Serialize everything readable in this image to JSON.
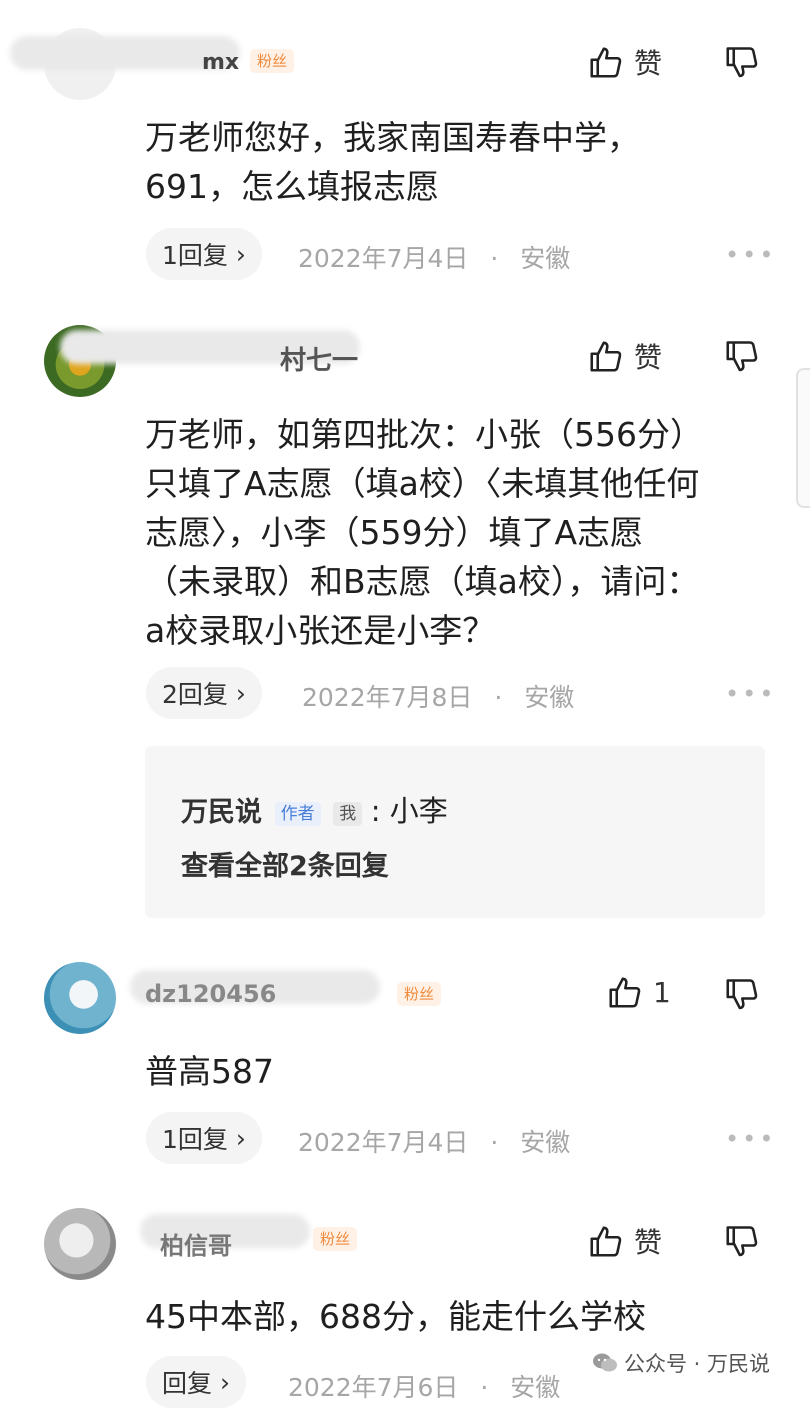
{
  "comments": [
    {
      "name_tail": "mx",
      "badge": "粉丝",
      "like_label": "赞",
      "text_lines": [
        "万老师您好，我家南国寿春中学，",
        "691，怎么填报志愿"
      ],
      "replies_label": "1回复",
      "date": "2022年7月4日",
      "location": "安徽"
    },
    {
      "name_tail": "村七一",
      "like_label": "赞",
      "text_lines": [
        "万老师，如第四批次：小张（556分）",
        "只填了A志愿（填a校）〈未填其他任何",
        "志愿〉，小李（559分）填了A志愿",
        "（未录取）和B志愿（填a校），请问：",
        "a校录取小张还是小李？"
      ],
      "replies_label": "2回复",
      "date": "2022年7月8日",
      "location": "安徽",
      "sub_reply": {
        "author": "万民说",
        "author_tag": "作者",
        "me_tag": "我",
        "text": ": 小李",
        "view_all": "查看全部2条回复"
      }
    },
    {
      "name_tail": "dz120456",
      "badge": "粉丝",
      "like_count": "1",
      "text_lines": [
        "普高587"
      ],
      "replies_label": "1回复",
      "date": "2022年7月4日",
      "location": "安徽"
    },
    {
      "name_tail": "柏信哥",
      "badge": "粉丝",
      "like_label": "赞",
      "text_lines": [
        "45中本部，688分，能走什么学校"
      ],
      "replies_label": "回复",
      "date": "2022年7月6日",
      "location": "安徽"
    }
  ],
  "separator": "·",
  "more_icon": "•••",
  "watermark": "公众号 · 万民说",
  "colors": {
    "badge": "#f08a3c",
    "author_tag": "#4a7fd8",
    "meta": "#a6a6a6"
  }
}
